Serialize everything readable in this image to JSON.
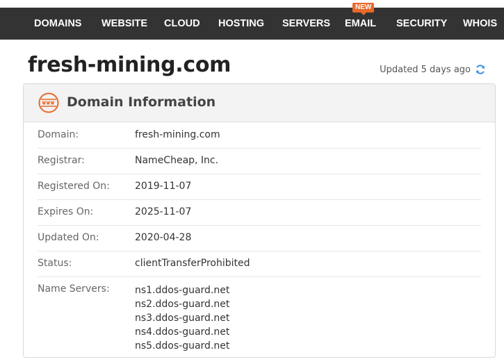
{
  "nav": {
    "items": [
      {
        "label": "DOMAINS"
      },
      {
        "label": "WEBSITE"
      },
      {
        "label": "CLOUD"
      },
      {
        "label": "HOSTING"
      },
      {
        "label": "SERVERS"
      },
      {
        "label": "EMAIL"
      },
      {
        "label": "SECURITY"
      },
      {
        "label": "WHOIS"
      }
    ],
    "email_badge": "NEW",
    "background_color": "#333333",
    "badge_color": "#e8692a"
  },
  "page": {
    "title": "fresh-mining.com",
    "updated_text": "Updated 5 days ago",
    "refresh_icon": "refresh-icon"
  },
  "panel": {
    "icon": "www-icon",
    "title": "Domain Information",
    "rows": [
      {
        "label": "Domain:",
        "value": "fresh-mining.com"
      },
      {
        "label": "Registrar:",
        "value": "NameCheap, Inc."
      },
      {
        "label": "Registered On:",
        "value": "2019-11-07"
      },
      {
        "label": "Expires On:",
        "value": "2025-11-07"
      },
      {
        "label": "Updated On:",
        "value": "2020-04-28"
      },
      {
        "label": "Status:",
        "value": "clientTransferProhibited"
      }
    ],
    "name_servers_label": "Name Servers:",
    "name_servers": [
      "ns1.ddos-guard.net",
      "ns2.ddos-guard.net",
      "ns3.ddos-guard.net",
      "ns4.ddos-guard.net",
      "ns5.ddos-guard.net"
    ]
  }
}
